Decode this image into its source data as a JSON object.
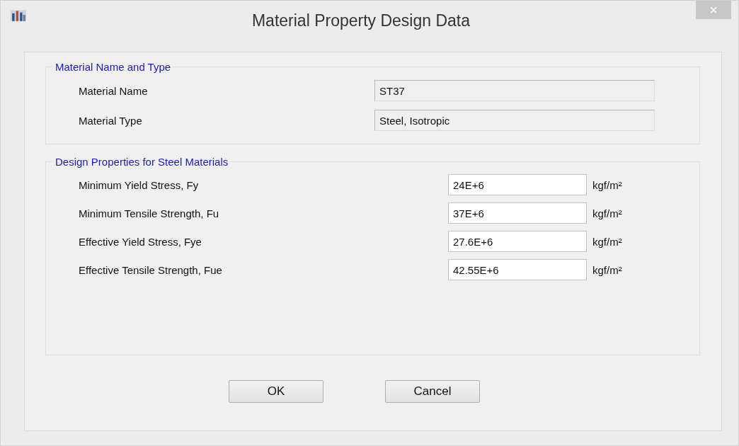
{
  "window": {
    "title": "Material Property Design Data",
    "close": "×"
  },
  "groups": [
    {
      "title": "Material Name and Type",
      "kind": "info",
      "fields": [
        {
          "label": "Material Name",
          "value": "ST37",
          "readonly": true
        },
        {
          "label": "Material Type",
          "value": "Steel, Isotropic",
          "readonly": true
        }
      ]
    },
    {
      "title": "Design Properties for Steel Materials",
      "kind": "props",
      "fields": [
        {
          "label": "Minimum Yield Stress, Fy",
          "value": "24E+6",
          "readonly": false,
          "unit": "kgf/m²"
        },
        {
          "label": "Minimum Tensile Strength, Fu",
          "value": "37E+6",
          "readonly": false,
          "unit": "kgf/m²"
        },
        {
          "label": "Effective Yield Stress, Fye",
          "value": "27.6E+6",
          "readonly": false,
          "unit": "kgf/m²"
        },
        {
          "label": "Effective Tensile Strength, Fue",
          "value": "42.55E+6",
          "readonly": false,
          "unit": "kgf/m²"
        }
      ]
    }
  ],
  "buttons": [
    "OK",
    "Cancel"
  ]
}
